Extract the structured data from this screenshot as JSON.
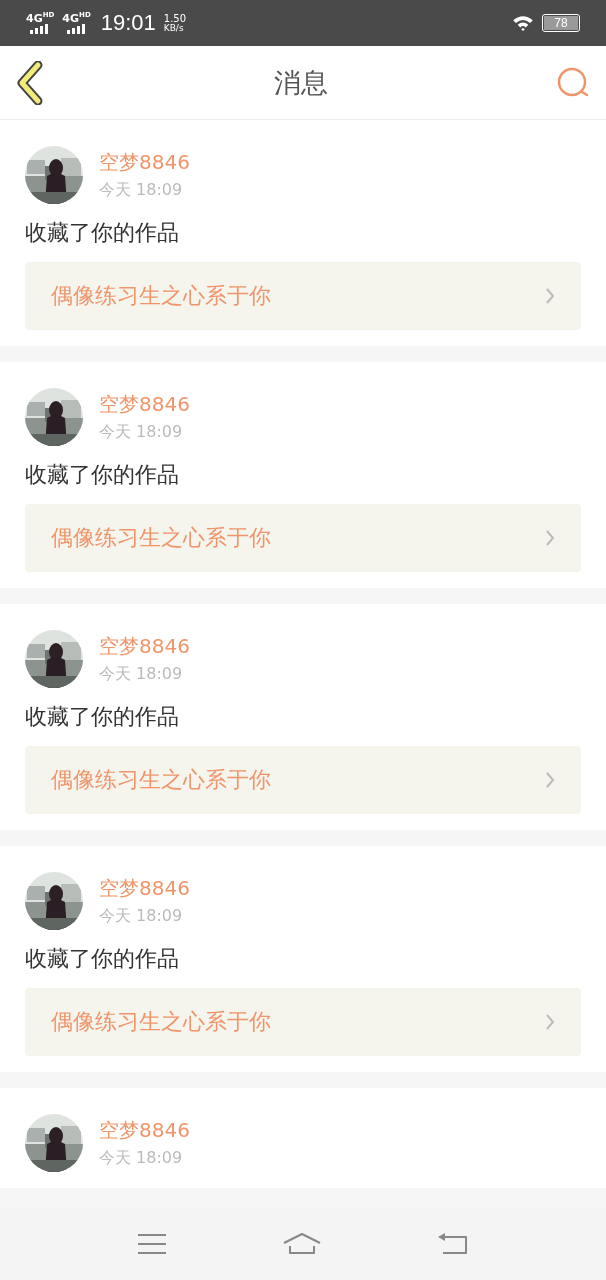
{
  "status_bar": {
    "signals": [
      "4G$^{HD}$",
      "4G$^{HD}$"
    ],
    "time": "19:01",
    "speed": "1.50",
    "speed_unit": "KB/s",
    "battery": "78"
  },
  "header": {
    "title": "消息"
  },
  "messages": [
    {
      "user": "空梦8846",
      "time": "今天 18:09",
      "action": "收藏了你的作品",
      "work": "偶像练习生之心系于你"
    },
    {
      "user": "空梦8846",
      "time": "今天 18:09",
      "action": "收藏了你的作品",
      "work": "偶像练习生之心系于你"
    },
    {
      "user": "空梦8846",
      "time": "今天 18:09",
      "action": "收藏了你的作品",
      "work": "偶像练习生之心系于你"
    },
    {
      "user": "空梦8846",
      "time": "今天 18:09",
      "action": "收藏了你的作品",
      "work": "偶像练习生之心系于你"
    },
    {
      "user": "空梦8846",
      "time": "今天 18:09"
    }
  ]
}
